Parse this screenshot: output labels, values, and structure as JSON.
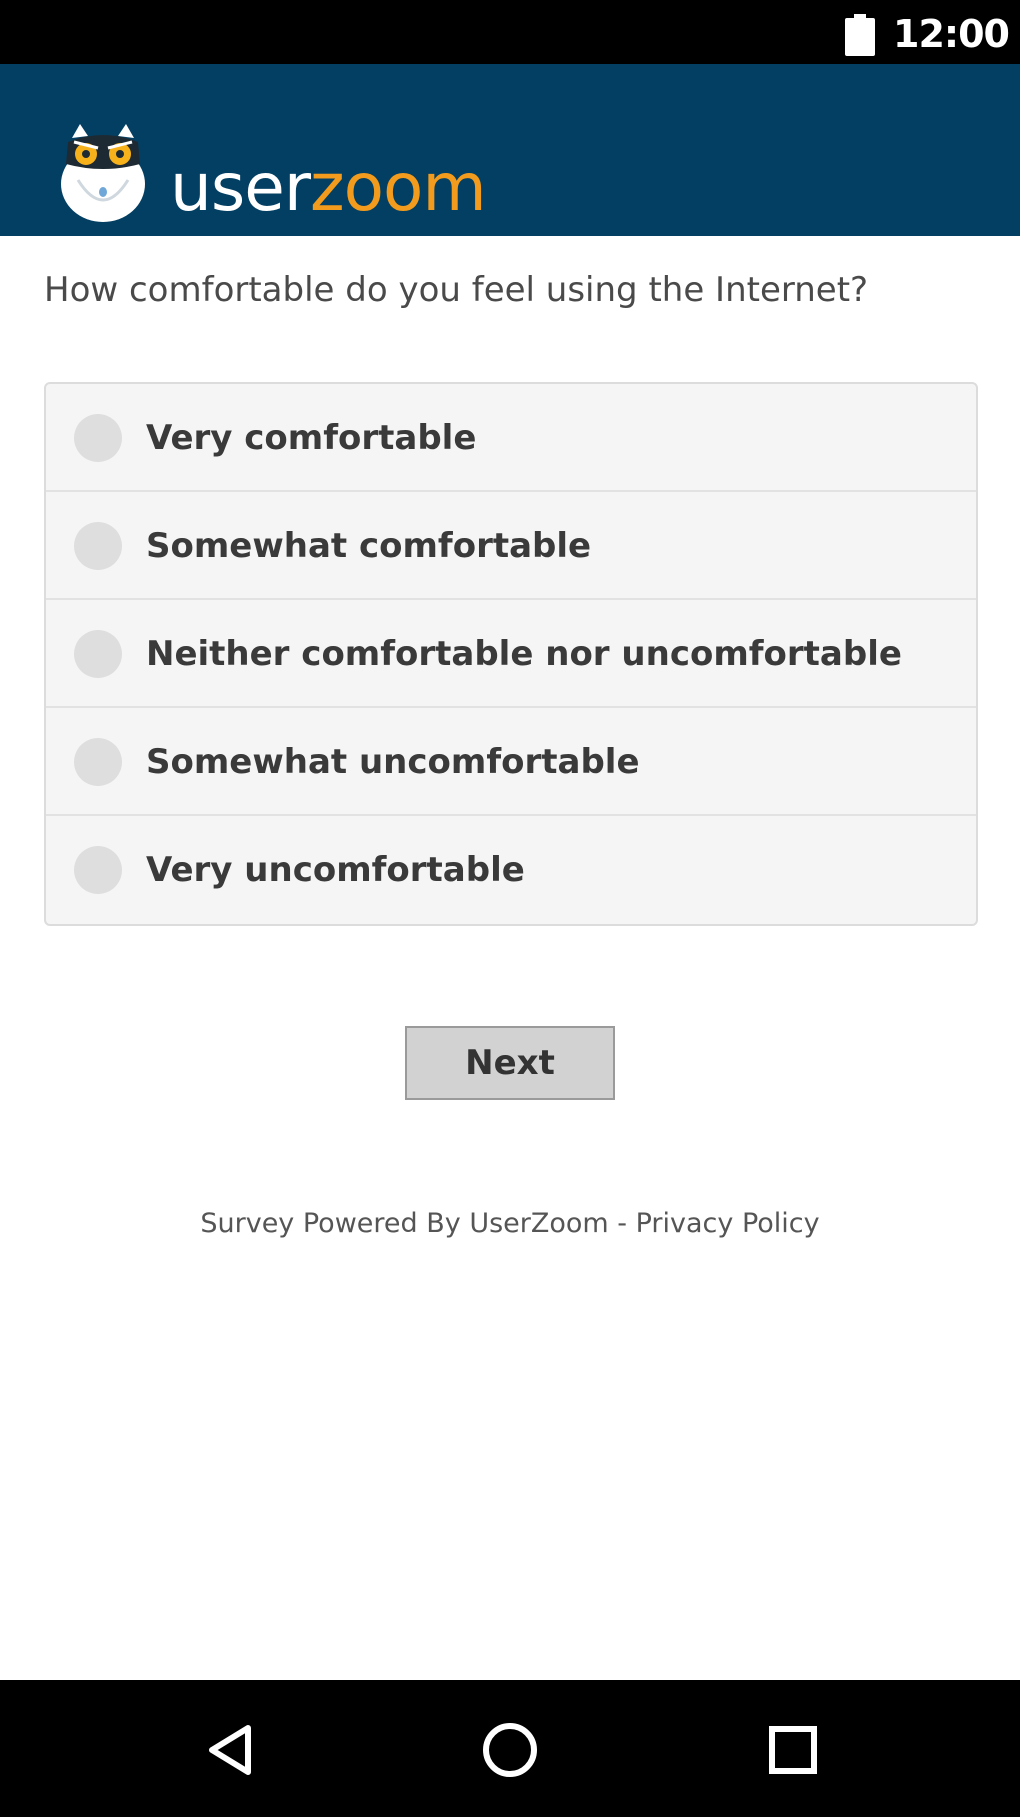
{
  "status_bar": {
    "time": "12:00",
    "battery_icon": "battery-full-icon"
  },
  "header": {
    "logo_icon": "owl-logo-icon",
    "brand_part1": "user",
    "brand_part2": "zoom",
    "brand_colors": {
      "user": "#ffffff",
      "zoom": "#f29b1c"
    },
    "background": "#033f63"
  },
  "survey": {
    "question": "How comfortable do you feel using the Internet?",
    "options": [
      {
        "label": "Very comfortable"
      },
      {
        "label": "Somewhat comfortable"
      },
      {
        "label": "Neither comfortable nor uncomfortable"
      },
      {
        "label": "Somewhat uncomfortable"
      },
      {
        "label": "Very uncomfortable"
      }
    ],
    "next_label": "Next"
  },
  "footer": {
    "powered_by": "Survey Powered By UserZoom",
    "separator": " - ",
    "privacy_link": "Privacy Policy"
  },
  "nav_bar": {
    "back_icon": "back-triangle-icon",
    "home_icon": "home-circle-icon",
    "recents_icon": "recents-square-icon"
  }
}
